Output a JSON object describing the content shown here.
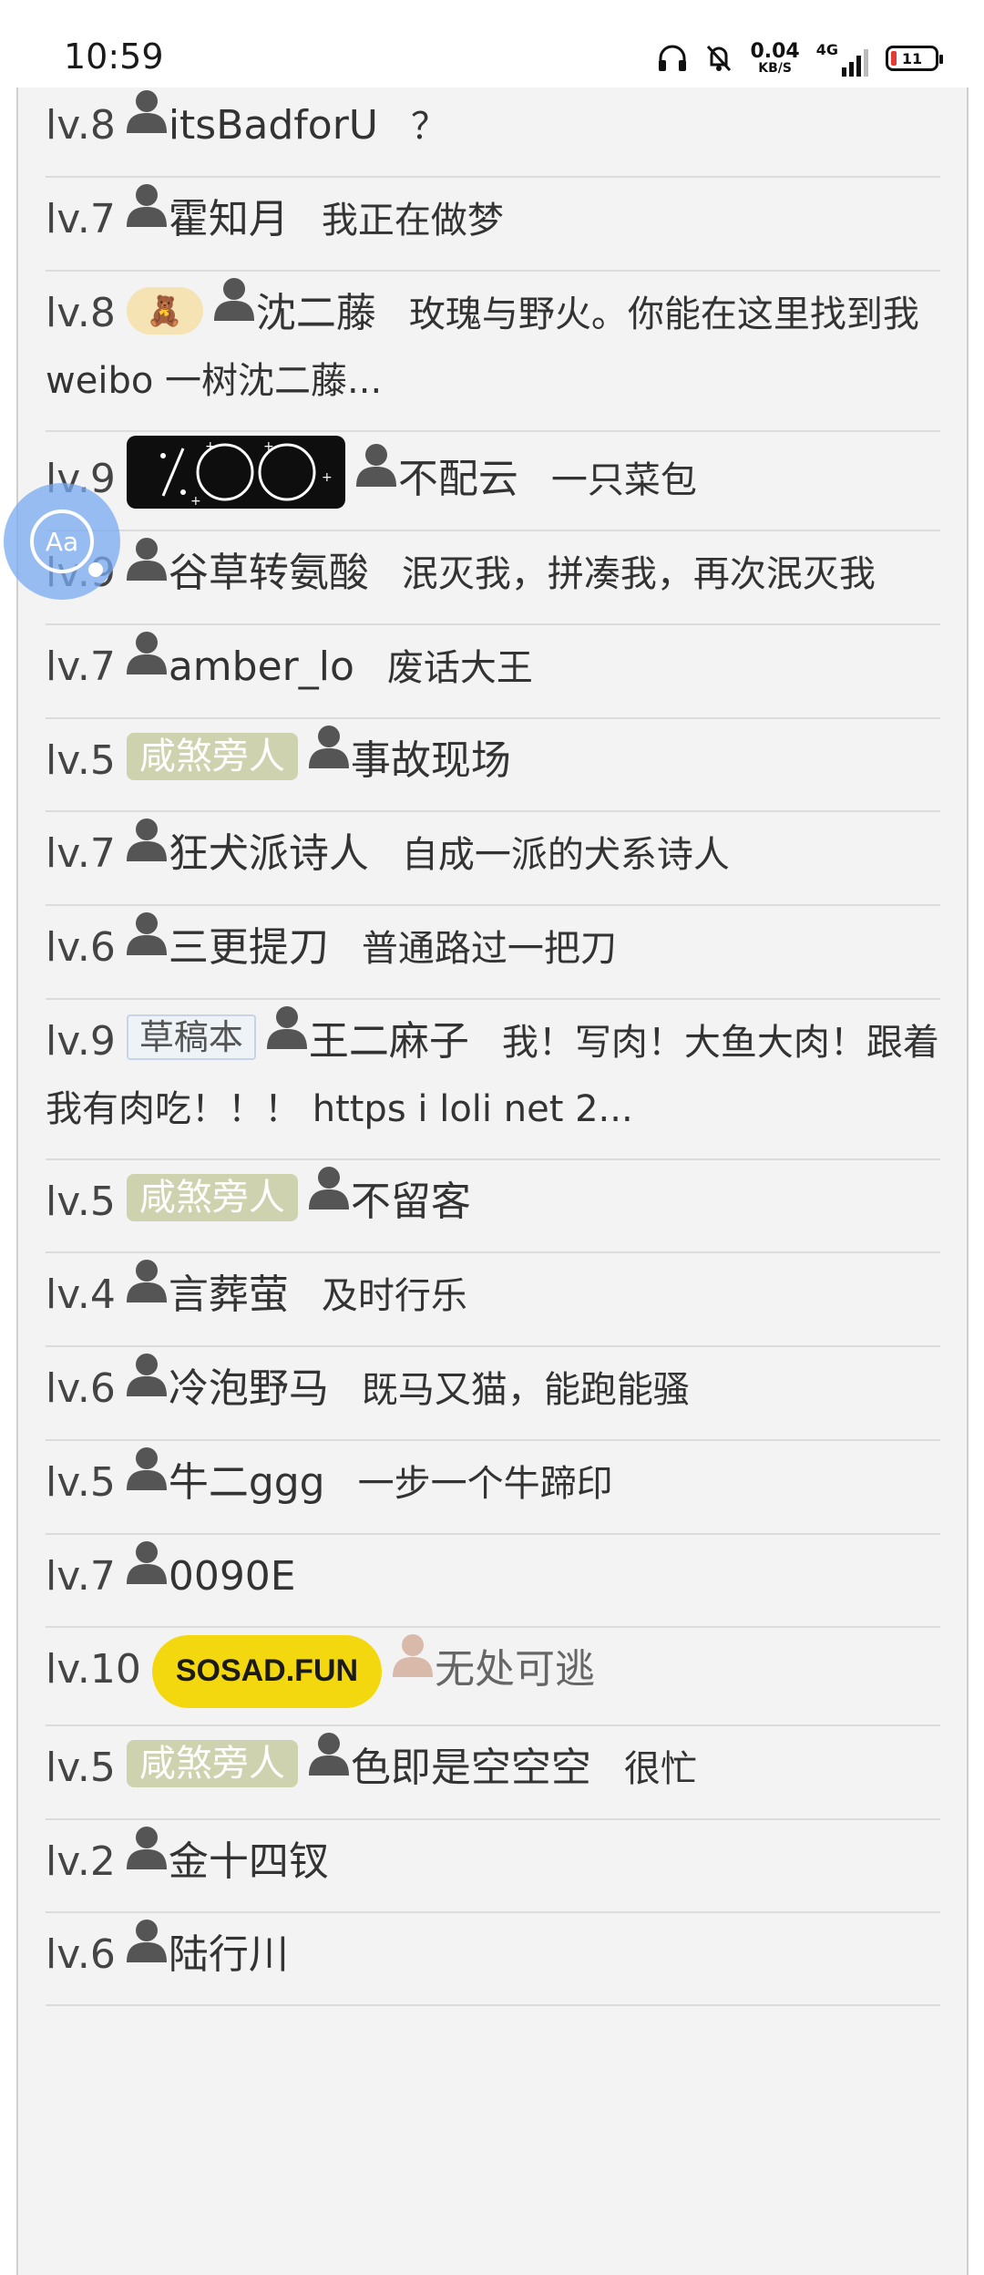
{
  "status_bar": {
    "time": "10:59",
    "speed_value": "0.04",
    "speed_unit": "KB/S",
    "network": "4G",
    "battery": "11"
  },
  "rows": [
    {
      "level": "lv.8",
      "name": "itsBadforU",
      "desc": "？"
    },
    {
      "level": "lv.7",
      "name": "霍知月",
      "desc": "我正在做梦"
    },
    {
      "level": "lv.8",
      "name": "沈二藤",
      "desc": "玫瑰与野火。你能在这里找到我weibo 一树沈二藤..."
    },
    {
      "level": "lv.9",
      "name": "不配云",
      "desc": "一只菜包"
    },
    {
      "level": "lv.9",
      "name": "谷草转氨酸",
      "desc": "泯灭我，拼凑我，再次泯灭我"
    },
    {
      "level": "lv.7",
      "name": "amber_lo",
      "desc": "废话大王"
    },
    {
      "level": "lv.5",
      "badge": "咸煞旁人",
      "name": "事故现场",
      "desc": ""
    },
    {
      "level": "lv.7",
      "name": "狂犬派诗人",
      "desc": "自成一派的犬系诗人"
    },
    {
      "level": "lv.6",
      "name": "三更提刀",
      "desc": "普通路过一把刀"
    },
    {
      "level": "lv.9",
      "badge": "草稿本",
      "name": "王二麻子",
      "desc": "我！写肉！大鱼大肉！跟着我有肉吃！！！ https i loli net 2..."
    },
    {
      "level": "lv.5",
      "badge": "咸煞旁人",
      "name": "不留客",
      "desc": ""
    },
    {
      "level": "lv.4",
      "name": "言葬萤",
      "desc": "及时行乐"
    },
    {
      "level": "lv.6",
      "name": "冷泡野马",
      "desc": "既马又猫，能跑能骚"
    },
    {
      "level": "lv.5",
      "name": "牛二ggg",
      "desc": "一步一个牛蹄印"
    },
    {
      "level": "lv.7",
      "name": "0090E",
      "desc": ""
    },
    {
      "level": "lv.10",
      "badge": "SOSAD.FUN",
      "name": "无处可逃",
      "desc": ""
    },
    {
      "level": "lv.5",
      "badge": "咸煞旁人",
      "name": "色即是空空空",
      "desc": "很忙"
    },
    {
      "level": "lv.2",
      "name": "金十四钗",
      "desc": ""
    },
    {
      "level": "lv.6",
      "name": "陆行川",
      "desc": ""
    }
  ],
  "floating_button": {
    "label": "Aa"
  },
  "colors": {
    "panel_bg": "#f3f3f3",
    "divider": "#dcdcdc",
    "badge_olive": "#cfd2ae",
    "badge_yellow": "#f4d80f",
    "fab_blue": "#78aaf0"
  }
}
